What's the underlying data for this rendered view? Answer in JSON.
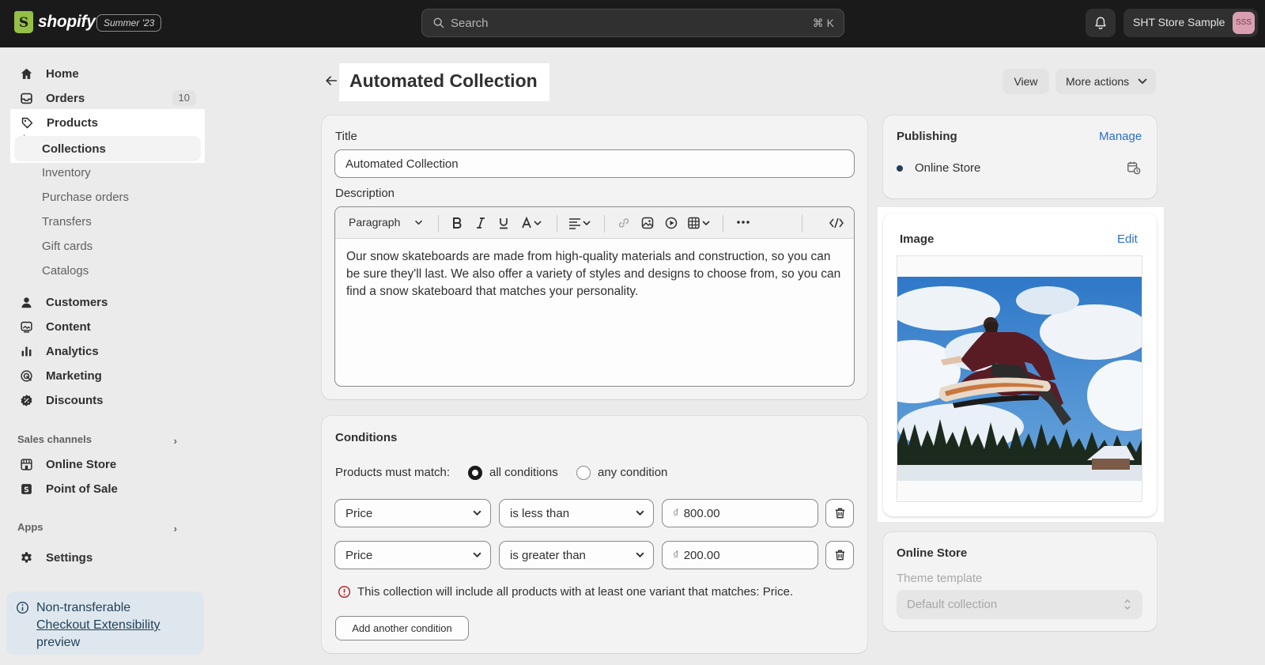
{
  "topbar": {
    "logo_text": "shopify",
    "edition_badge": "Summer '23",
    "search_placeholder": "Search",
    "search_shortcut": "⌘ K",
    "store_name": "SHT Store Sample",
    "avatar_initials": "SSS"
  },
  "sidebar": {
    "items": [
      {
        "label": "Home",
        "icon": "home-icon"
      },
      {
        "label": "Orders",
        "icon": "inbox-icon",
        "badge": "10"
      },
      {
        "label": "Products",
        "icon": "tag-icon"
      }
    ],
    "product_subitems": [
      "Collections",
      "Inventory",
      "Purchase orders",
      "Transfers",
      "Gift cards",
      "Catalogs"
    ],
    "items2": [
      {
        "label": "Customers",
        "icon": "person-icon"
      },
      {
        "label": "Content",
        "icon": "content-icon"
      },
      {
        "label": "Analytics",
        "icon": "bar-chart-icon"
      },
      {
        "label": "Marketing",
        "icon": "target-icon"
      },
      {
        "label": "Discounts",
        "icon": "discount-icon"
      }
    ],
    "sales_channels_heading": "Sales channels",
    "channels": [
      {
        "label": "Online Store",
        "icon": "store-icon"
      },
      {
        "label": "Point of Sale",
        "icon": "pos-icon"
      }
    ],
    "apps_heading": "Apps",
    "settings_label": "Settings",
    "banner": {
      "line1": "Non-transferable",
      "link": "Checkout Extensibility",
      "line3": "preview"
    }
  },
  "header": {
    "title": "Automated Collection",
    "view_button": "View",
    "more_actions_button": "More actions"
  },
  "main_card": {
    "title_label": "Title",
    "title_value": "Automated Collection",
    "description_label": "Description",
    "toolbar_paragraph": "Paragraph",
    "description_text": "Our snow skateboards are made from high-quality materials and construction, so you can be sure they'll last. We also offer a variety of styles and designs to choose from, so you can find a snow skateboard that matches your personality."
  },
  "conditions": {
    "title": "Conditions",
    "match_label": "Products must match:",
    "option_all": "all conditions",
    "option_any": "any condition",
    "selected_option": "all conditions",
    "currency_symbol": "₫",
    "rows": [
      {
        "field": "Price",
        "operator": "is less than",
        "value": "800.00"
      },
      {
        "field": "Price",
        "operator": "is greater than",
        "value": "200.00"
      }
    ],
    "info_text": "This collection will include all products with at least one variant that matches: Price.",
    "add_button": "Add another condition"
  },
  "publishing": {
    "title": "Publishing",
    "manage_link": "Manage",
    "channel": "Online Store"
  },
  "image_card": {
    "title": "Image",
    "edit_link": "Edit"
  },
  "online_store_card": {
    "title": "Online Store",
    "theme_label": "Theme template",
    "theme_value": "Default collection"
  },
  "colors": {
    "topbar_bg": "#1a1a1a",
    "accent_link": "#2c6ecb",
    "page_bg": "#ebebeb"
  }
}
